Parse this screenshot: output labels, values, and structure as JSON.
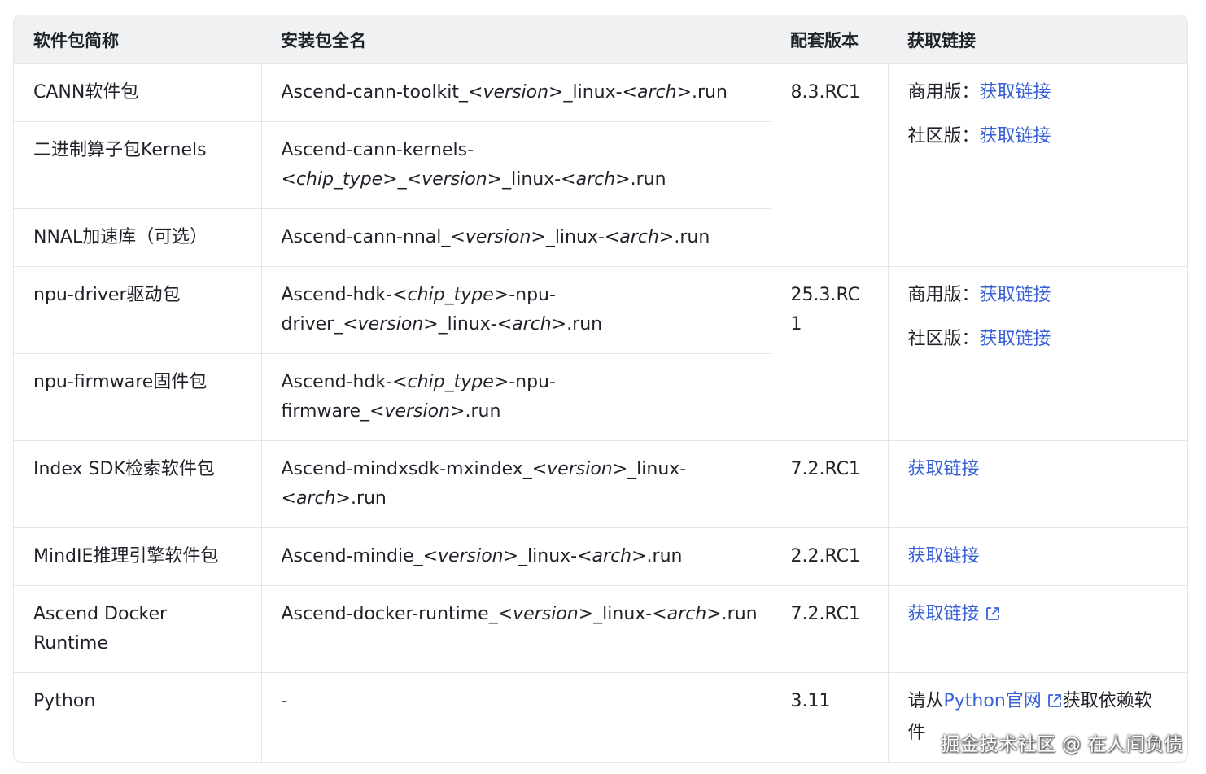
{
  "table": {
    "headers": [
      "软件包简称",
      "安装包全名",
      "配套版本",
      "获取链接"
    ],
    "rows": [
      {
        "name": "CANN软件包",
        "file_prefix": "Ascend-cann-toolkit_",
        "file_v1": "version",
        "file_mid": ">_linux-<",
        "file_v2": "arch",
        "file_suffix": ">.run"
      },
      {
        "name": "二进制算子包Kernels"
      },
      {
        "name": "NNAL加速库（可选）"
      },
      {
        "name": "npu-driver驱动包"
      },
      {
        "name": "npu-firmware固件包"
      },
      {
        "name": "Index SDK检索软件包"
      },
      {
        "name": "MindIE推理引擎软件包"
      },
      {
        "name": "Ascend Docker Runtime"
      },
      {
        "name": "Python"
      }
    ],
    "files": {
      "toolkit": {
        "a": "Ascend-cann-toolkit_<",
        "b": "version",
        "c": ">_linux-<",
        "d": "arch",
        "e": ">.run"
      },
      "kernels": {
        "a": "Ascend-cann-kernels-<",
        "b": "chip_type",
        "c": ">_<",
        "d": "version",
        "e": ">_linux-<",
        "f": "arch",
        "g": ">.run"
      },
      "nnal": {
        "a": "Ascend-cann-nnal_<",
        "b": "version",
        "c": ">_linux-<",
        "d": "arch",
        "e": ">.run"
      },
      "driver": {
        "a": "Ascend-hdk-<",
        "b": "chip_type",
        "c": ">-npu-driver_<",
        "d": "version",
        "e": ">_linux-<",
        "f": "arch",
        "g": ">.run"
      },
      "firmware": {
        "a": "Ascend-hdk-<",
        "b": "chip_type",
        "c": ">-npu-firmware_<",
        "d": "version",
        "e": ">.run"
      },
      "mxindex": {
        "a": "Ascend-mindxsdk-mxindex_<",
        "b": "version",
        "c": ">_linux-<",
        "d": "arch",
        "e": ">.run"
      },
      "mindie": {
        "a": "Ascend-mindie_<",
        "b": "version",
        "c": ">_linux-<",
        "d": "arch",
        "e": ">.run"
      },
      "docker": {
        "a": "Ascend-docker-runtime_<",
        "b": "version",
        "c": ">_linux-<",
        "d": "arch",
        "e": ">.run"
      },
      "python": "-"
    },
    "versions": {
      "cann": "8.3.RC1",
      "hdk": "25.3.RC1",
      "mxindex": "7.2.RC1",
      "mindie": "2.2.RC1",
      "docker": "7.2.RC1",
      "python": "3.11"
    },
    "links": {
      "commercial_label": "商用版：",
      "community_label": "社区版：",
      "get_link": "获取链接",
      "python_prefix": "请从",
      "python_link": "Python官网",
      "python_suffix": "获取依赖软件"
    }
  },
  "watermark": "掘金技术社区 @ 在人间负债",
  "colors": {
    "link": "#3860d6",
    "header_bg": "#f0f1f3",
    "border": "#e3e5e8"
  }
}
